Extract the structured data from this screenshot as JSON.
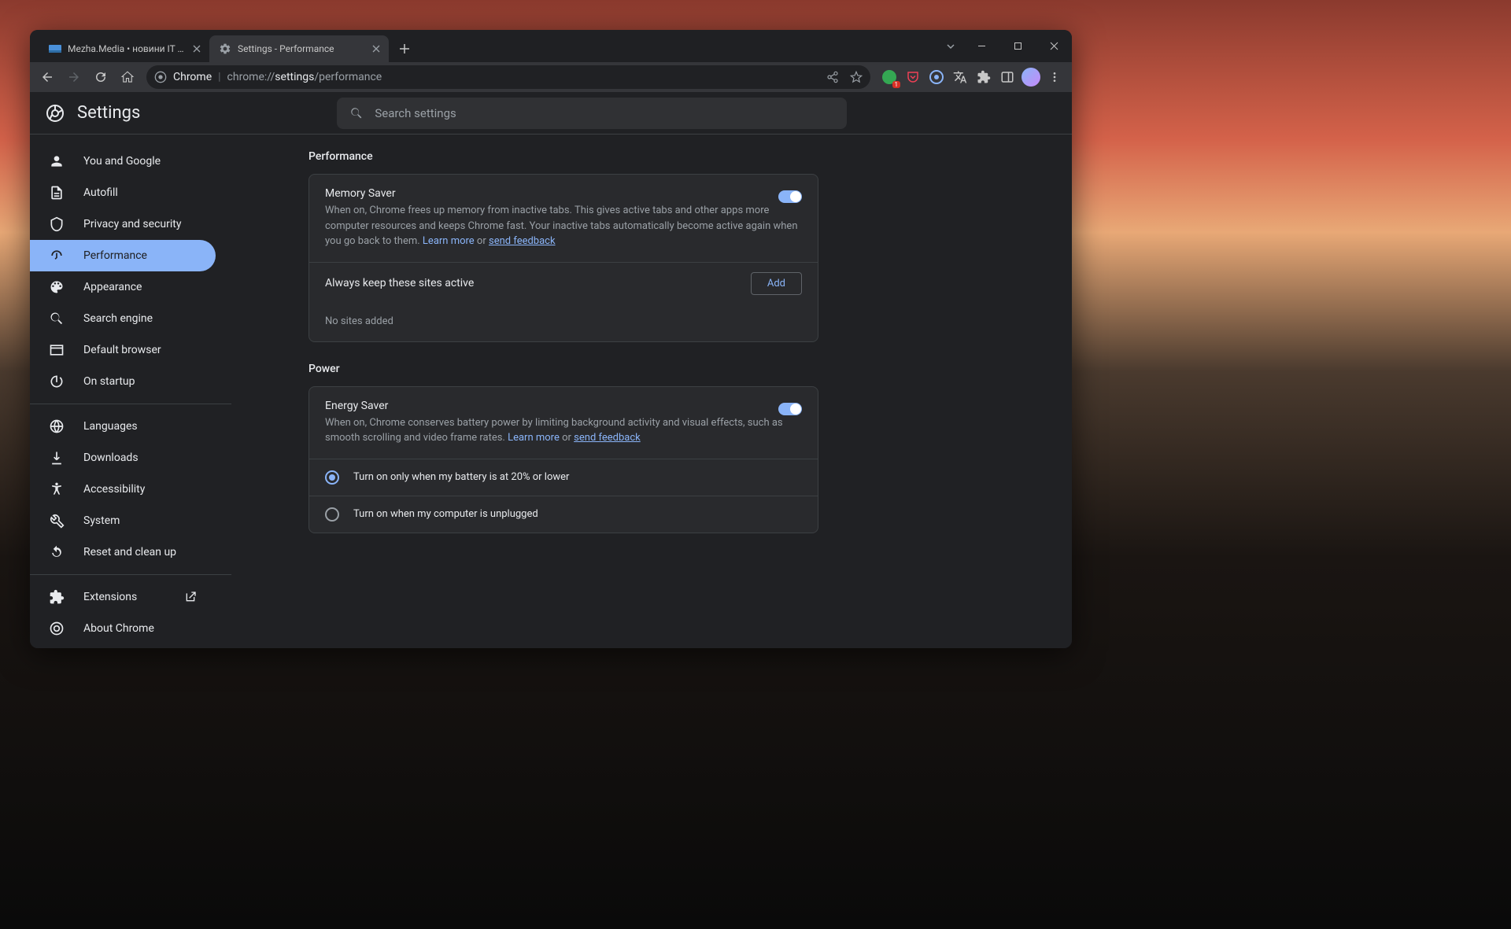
{
  "tabs": [
    {
      "title": "Mezha.Media • новини IT та огл",
      "active": false
    },
    {
      "title": "Settings - Performance",
      "active": true
    }
  ],
  "omnibox": {
    "chrome_label": "Chrome",
    "url_prefix": "chrome://",
    "url_bold": "settings",
    "url_suffix": "/performance"
  },
  "toolbar_badge": "1",
  "settings_title": "Settings",
  "search_placeholder": "Search settings",
  "sidebar": {
    "items_main": [
      {
        "id": "you-google",
        "label": "You and Google",
        "icon": "person"
      },
      {
        "id": "autofill",
        "label": "Autofill",
        "icon": "autofill"
      },
      {
        "id": "privacy",
        "label": "Privacy and security",
        "icon": "shield"
      },
      {
        "id": "performance",
        "label": "Performance",
        "icon": "speed",
        "active": true
      },
      {
        "id": "appearance",
        "label": "Appearance",
        "icon": "palette"
      },
      {
        "id": "search-engine",
        "label": "Search engine",
        "icon": "search"
      },
      {
        "id": "default-browser",
        "label": "Default browser",
        "icon": "browser"
      },
      {
        "id": "on-startup",
        "label": "On startup",
        "icon": "power"
      }
    ],
    "items_secondary": [
      {
        "id": "languages",
        "label": "Languages",
        "icon": "globe"
      },
      {
        "id": "downloads",
        "label": "Downloads",
        "icon": "download"
      },
      {
        "id": "accessibility",
        "label": "Accessibility",
        "icon": "accessibility"
      },
      {
        "id": "system",
        "label": "System",
        "icon": "wrench"
      },
      {
        "id": "reset",
        "label": "Reset and clean up",
        "icon": "reset"
      }
    ],
    "items_footer": [
      {
        "id": "extensions",
        "label": "Extensions",
        "icon": "puzzle",
        "external": true
      },
      {
        "id": "about",
        "label": "About Chrome",
        "icon": "chrome"
      }
    ]
  },
  "content": {
    "performance": {
      "title": "Performance",
      "memory_saver": {
        "title": "Memory Saver",
        "desc": "When on, Chrome frees up memory from inactive tabs. This gives active tabs and other apps more computer resources and keeps Chrome fast. Your inactive tabs automatically become active again when you go back to them. ",
        "learn_more": "Learn more",
        "or": " or ",
        "send_feedback": "send feedback",
        "toggle_on": true,
        "always_active_label": "Always keep these sites active",
        "add_button": "Add",
        "empty": "No sites added"
      }
    },
    "power": {
      "title": "Power",
      "energy_saver": {
        "title": "Energy Saver",
        "desc": "When on, Chrome conserves battery power by limiting background activity and visual effects, such as smooth scrolling and video frame rates. ",
        "learn_more": "Learn more",
        "or": " or ",
        "send_feedback": "send feedback",
        "toggle_on": true,
        "radio1": "Turn on only when my battery is at 20% or lower",
        "radio2": "Turn on when my computer is unplugged",
        "selected": 0
      }
    }
  }
}
